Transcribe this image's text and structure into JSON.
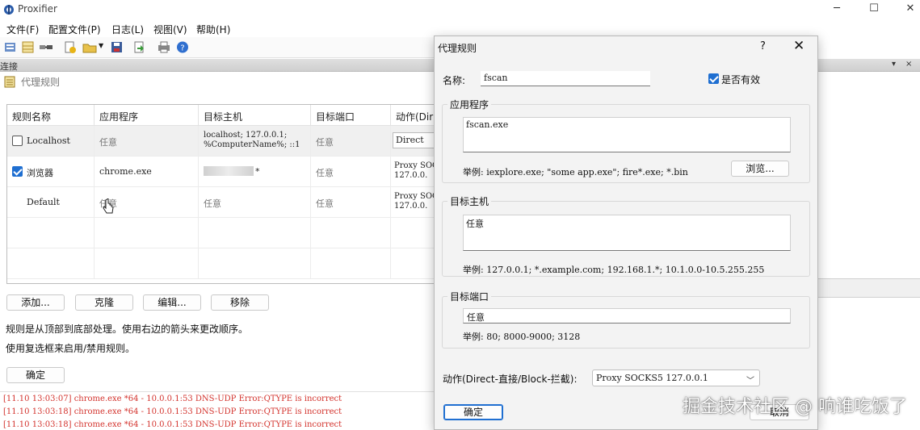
{
  "window": {
    "title": "Proxifier",
    "min_icon": "minimize-icon",
    "max_icon": "maximize-icon",
    "close_icon": "close-icon"
  },
  "menu": [
    "文件(F)",
    "配置文件(P)",
    "日志(L)",
    "视图(V)",
    "帮助(H)"
  ],
  "toolbar_icons": [
    "profile-icon",
    "grid-icon",
    "connection-icon",
    "add-profile-icon",
    "open-folder-icon",
    "dropdown-icon",
    "save-icon",
    "export-icon",
    "print-icon",
    "help-icon"
  ],
  "connection_bar": {
    "label": "连接",
    "pin": "▾",
    "close": "×"
  },
  "panel": {
    "title": "代理规则",
    "icon": "rules-icon"
  },
  "table": {
    "headers": [
      "规则名称",
      "应用程序",
      "目标主机",
      "目标端口",
      "动作(Dir"
    ],
    "rows": [
      {
        "checked": false,
        "name": "Localhost",
        "app": "任意",
        "host_line1": "localhost; 127.0.0.1;",
        "host_line2": "%ComputerName%; ::1",
        "port": "任意",
        "action": "Direct"
      },
      {
        "checked": true,
        "name": "浏览器",
        "app": "chrome.exe",
        "host": "*",
        "port": "任意",
        "action_line1": "Proxy SOC",
        "action_line2": "127.0.0."
      },
      {
        "checked": null,
        "name": "Default",
        "app": "任意",
        "host": "任意",
        "port": "任意",
        "action_line1": "Proxy SOC",
        "action_line2": "127.0.0."
      }
    ]
  },
  "buttons": {
    "add": "添加...",
    "clone": "克隆",
    "edit": "编辑...",
    "remove": "移除",
    "ok": "确定"
  },
  "hints": [
    "规则是从顶部到底部处理。使用右边的箭头来更改顺序。",
    "使用复选框来启用/禁用规则。"
  ],
  "log_lines": [
    "[11.10 13:03:07] chrome.exe *64 - 10.0.0.1:53 DNS-UDP Error:QTYPE is incorrect",
    "[11.10 13:03:18] chrome.exe *64 - 10.0.0.1:53 DNS-UDP Error:QTYPE is incorrect",
    "[11.10 13:03:18] chrome.exe *64 - 10.0.0.1:53 DNS-UDP Error:QTYPE is incorrect"
  ],
  "dialog": {
    "title": "代理规则",
    "help": "?",
    "close": "✕",
    "name_label": "名称:",
    "name_value": "fscan",
    "enabled_label": "是否有效",
    "enabled": true,
    "app_group": "应用程序",
    "app_value": "fscan.exe",
    "app_example": "举例: iexplore.exe; \"some app.exe\"; fire*.exe; *.bin",
    "browse": "浏览...",
    "host_group": "目标主机",
    "host_value": "任意",
    "host_example": "举例: 127.0.0.1; *.example.com; 192.168.1.*; 10.1.0.0-10.5.255.255",
    "port_group": "目标端口",
    "port_value": "任意",
    "port_example": "举例: 80; 8000-9000; 3128",
    "action_label": "动作(Direct-直接/Block-拦截):",
    "action_value": "Proxy SOCKS5 127.0.0.1",
    "ok": "确定",
    "cancel": "取消"
  },
  "watermark": "掘金技术社区 @ 响谁吃饭了",
  "colors": {
    "accent": "#1f6fd1",
    "log_error": "#d3322c"
  }
}
